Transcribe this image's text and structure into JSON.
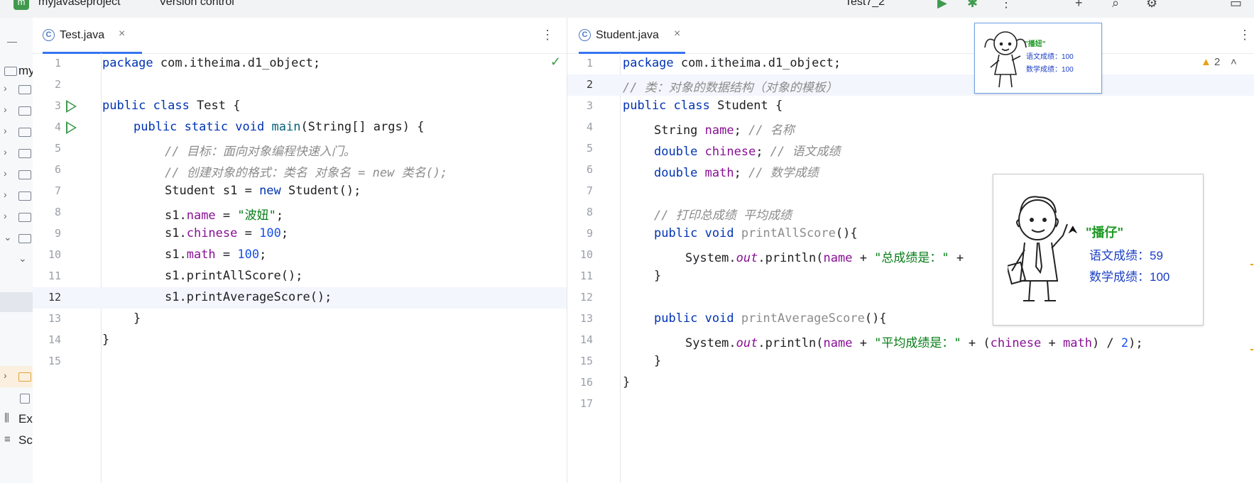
{
  "topbar": {
    "project_badge": "m",
    "project_name": "myjavaseproject",
    "version_control": "Version control",
    "run_config": "Test7_2"
  },
  "sidebar": {
    "project_label": "my",
    "external_label": "Ex",
    "scratches_label": "Sc"
  },
  "left_editor": {
    "tab_title": "Test.java",
    "lines": [
      {
        "n": "1"
      },
      {
        "n": "2"
      },
      {
        "n": "3"
      },
      {
        "n": "4"
      },
      {
        "n": "5"
      },
      {
        "n": "6"
      },
      {
        "n": "7"
      },
      {
        "n": "8"
      },
      {
        "n": "9"
      },
      {
        "n": "10"
      },
      {
        "n": "11"
      },
      {
        "n": "12"
      },
      {
        "n": "13"
      },
      {
        "n": "14"
      },
      {
        "n": "15"
      }
    ],
    "code": {
      "l1_kw": "package",
      "l1_rest": " com.itheima.d1_object;",
      "l3_kw": "public class",
      "l3_rest": " Test {",
      "l4_kw": "public static void",
      "l4_m": "main",
      "l4_rest": "(String[] args) {",
      "l5": "// 目标：面向对象编程快速入门。",
      "l6": "// 创建对象的格式：类名 对象名 = new 类名();",
      "l7_a": "Student s1 = ",
      "l7_kw": "new",
      "l7_b": " Student();",
      "l8_a": "s1.",
      "l8_f": "name",
      "l8_b": " = ",
      "l8_s": "\"波妞\"",
      "l8_c": ";",
      "l9_a": "s1.",
      "l9_f": "chinese",
      "l9_b": " = ",
      "l9_n": "100",
      "l9_c": ";",
      "l10_a": "s1.",
      "l10_f": "math",
      "l10_b": " = ",
      "l10_n": "100",
      "l10_c": ";",
      "l11": "s1.printAllScore();",
      "l12": "s1.printAverageScore();",
      "l13": "}",
      "l14": "}"
    }
  },
  "right_editor": {
    "tab_title": "Student.java",
    "warning_count": "2",
    "lines": [
      {
        "n": "1"
      },
      {
        "n": "2"
      },
      {
        "n": "3"
      },
      {
        "n": "4"
      },
      {
        "n": "5"
      },
      {
        "n": "6"
      },
      {
        "n": "7"
      },
      {
        "n": "8"
      },
      {
        "n": "9"
      },
      {
        "n": "10"
      },
      {
        "n": "11"
      },
      {
        "n": "12"
      },
      {
        "n": "13"
      },
      {
        "n": "14"
      },
      {
        "n": "15"
      },
      {
        "n": "16"
      },
      {
        "n": "17"
      }
    ],
    "code": {
      "l1_kw": "package",
      "l1_rest": " com.itheima.d1_object;",
      "l2": "// 类：对象的数据结构（对象的模板）",
      "l3_kw": "public class",
      "l3_rest": " Student {",
      "l4_a": "String ",
      "l4_f": "name",
      "l4_b": "; ",
      "l4_c": "// 名称",
      "l5_kw": "double ",
      "l5_f": "chinese",
      "l5_b": "; ",
      "l5_c": "// 语文成绩",
      "l6_kw": "double ",
      "l6_f": "math",
      "l6_b": "; ",
      "l6_c": "// 数学成绩",
      "l8": "// 打印总成绩 平均成绩",
      "l9_kw": "public void ",
      "l9_m": "printAllScore",
      "l9_b": "(){",
      "l10_a": "System.",
      "l10_o": "out",
      "l10_b": ".println(",
      "l10_f": "name",
      "l10_c": " + ",
      "l10_s": "\"总成绩是：\"",
      "l10_d": " +",
      "l11": "}",
      "l13_kw": "public void ",
      "l13_m": "printAverageScore",
      "l13_b": "(){",
      "l14_a": "System.",
      "l14_o": "out",
      "l14_b": ".println(",
      "l14_f": "name",
      "l14_c": " + ",
      "l14_s": "\"平均成绩是：\"",
      "l14_d": " + (",
      "l14_f2": "chinese",
      "l14_e": " + ",
      "l14_f3": "math",
      "l14_g": ") / ",
      "l14_n": "2",
      "l14_h": ");",
      "l15": "}",
      "l16": "}"
    }
  },
  "cards": {
    "small": {
      "name": "\"播妞\"",
      "chinese": "语文成绩：100",
      "math": "数学成绩：100"
    },
    "big": {
      "name": "\"播仔\"",
      "chinese": "语文成绩：59",
      "math": "数学成绩：100"
    }
  },
  "icons": {
    "run": "run-gutter-icon",
    "check": "check-icon",
    "warning": "warning-icon"
  },
  "colors": {
    "keyword": "#0033b3",
    "field": "#871094",
    "comment": "#8c8c8c",
    "string": "#067d17",
    "number": "#1750eb",
    "accent": "#3574f0",
    "card_name": "#1f9a26",
    "card_text": "#1b3fc4"
  }
}
